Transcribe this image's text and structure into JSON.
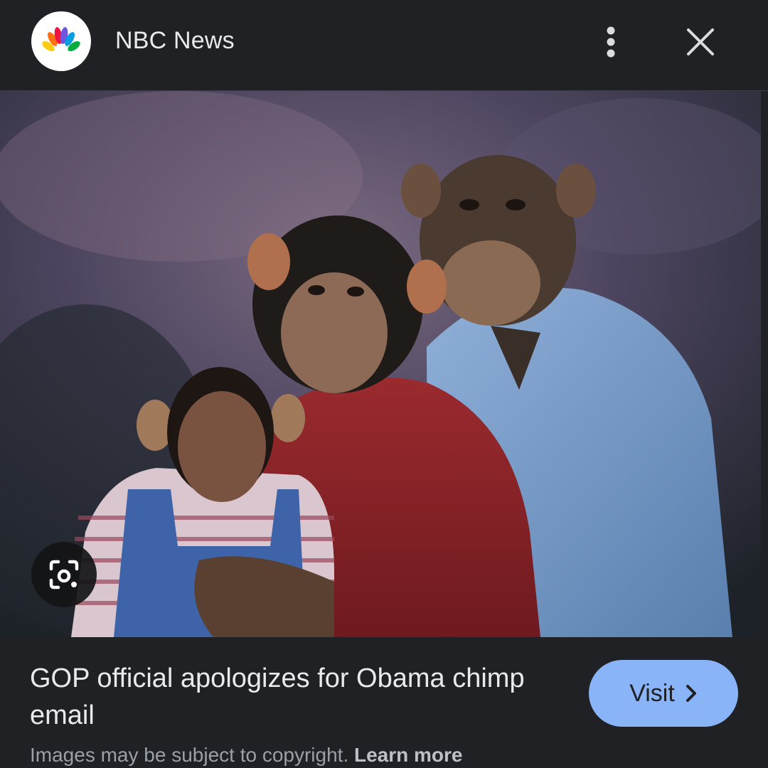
{
  "header": {
    "source_name": "NBC News",
    "logo_icon": "nbc-peacock-icon",
    "more_icon": "more-vert-icon",
    "close_icon": "close-icon"
  },
  "image": {
    "alt": "Photoshopped chimpanzee family portrait"
  },
  "lens": {
    "icon": "google-lens-icon"
  },
  "result": {
    "title": "GOP official apologizes for Obama chimp email",
    "visit_label": "Visit",
    "visit_icon": "chevron-right-icon"
  },
  "footer": {
    "copyright_text": "Images may be subject to copyright.",
    "learn_more_label": "Learn more"
  },
  "colors": {
    "background": "#202124",
    "text": "#e8eaed",
    "visit_button": "#8ab4f8",
    "muted_text": "#9aa0a6"
  }
}
